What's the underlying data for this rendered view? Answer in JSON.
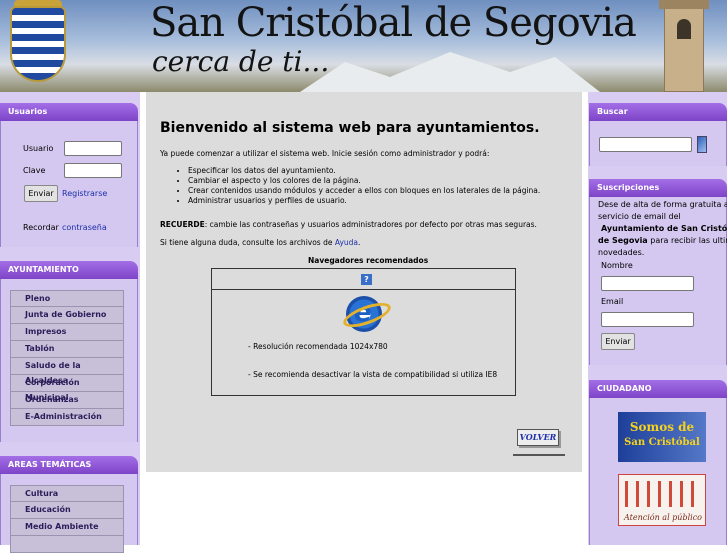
{
  "header": {
    "title": "San Cristóbal de Segovia",
    "subtitle": "cerca de ti..."
  },
  "usuarios": {
    "heading": "Usuarios",
    "usuario_label": "Usuario",
    "clave_label": "Clave",
    "enviar": "Enviar",
    "registrarse": "Registrarse",
    "recordar": "Recordar",
    "contrasena": "contraseña"
  },
  "ayuntamiento": {
    "heading": "AYUNTAMIENTO",
    "items": [
      "Pleno",
      "Junta de Gobierno",
      "Impresos",
      "Tablón",
      "Saludo de la Alcaldesa",
      "Corporación Municipal",
      "Ordenanzas",
      "E-Administración"
    ]
  },
  "areas": {
    "heading": "AREAS TEMÁTICAS",
    "items": [
      "Cultura",
      "Educación",
      "Medio Ambiente"
    ]
  },
  "main": {
    "welcome": "Bienvenido al sistema web para ayuntamientos.",
    "intro": "Ya puede comenzar a utilizar el sistema web. Inicie sesión como administrador y podrá:",
    "bullets": [
      "Especificar los datos del ayuntamiento.",
      "Cambiar el aspecto y los colores de la página.",
      "Crear contenidos usando módulos y acceder a ellos con bloques en los laterales de la página.",
      "Administrar usuarios y perfiles de usuario."
    ],
    "recuerde_bold": "RECUERDE",
    "recuerde_text": ": cambie las contraseñas y usuarios administradores por defecto por otras mas seguras.",
    "doubt_text": "Si tiene alguna duda, consulte los archivos de ",
    "ayuda": "Ayuda",
    "doubt_end": ".",
    "browsers_title": "Navegadores recomendados",
    "qmark": "?",
    "resolution": "- Resolución recomendada 1024x780",
    "compat": "- Se recomienda desactivar la vista de compatibilidad si utiliza IE8",
    "volver": "VOLVER"
  },
  "buscar": {
    "heading": "Buscar"
  },
  "suscripciones": {
    "heading": "Suscripciones",
    "line1": "Dese de alta de forma gratuita al",
    "line2": "servicio de email del",
    "line3_bold": "Ayuntamiento de San Cristóbal",
    "line4_bold": "de Segovia",
    "line4_rest": " para recibir las ultimas",
    "line5": "novedades.",
    "nombre": "Nombre",
    "email": "Email",
    "enviar": "Enviar"
  },
  "ciudadano": {
    "heading": "CIUDADANO",
    "somos_line1": "Somos de",
    "somos_line2": "San Cristóbal",
    "atencion": "Atención al público"
  }
}
